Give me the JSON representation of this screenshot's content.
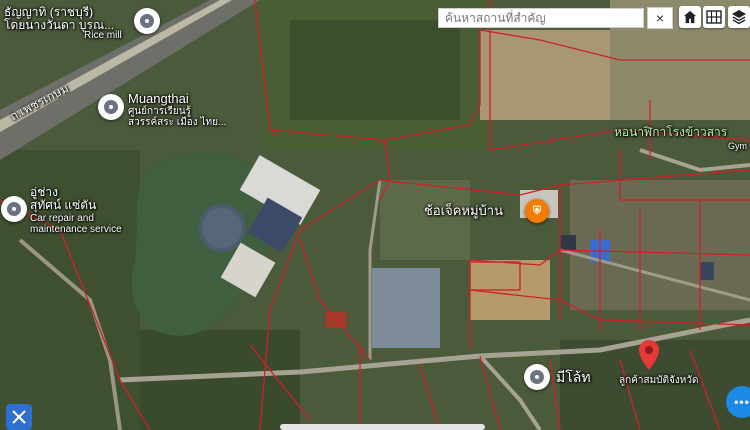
{
  "search": {
    "placeholder": "ค้นหาสถานที่สำคัญ",
    "clear_label": "×"
  },
  "controls": {
    "home_icon": "home-icon",
    "grid_icon": "grid-icon",
    "layers_icon": "layers-icon"
  },
  "places": [
    {
      "name": "ธัญญาทิ (ราชบุรี)\nโดยนางวันดา บูรณ...",
      "sub": "Rice mill"
    },
    {
      "name": "Muangthai",
      "sub": "ศูนย์การเรียนรู้\nสวรรค์สระ เมือง ไทย..."
    },
    {
      "name": "อู่ช่าง\nสุทัศน์ แซ่ตัน",
      "sub": "Car repair and\nmaintenance service"
    },
    {
      "name": "ช้อเจ็คหมู่บ้าน",
      "sub": ""
    },
    {
      "name": "หอนาฬิกาโรงข้าวสาร",
      "sub": "Gym"
    },
    {
      "name": "มีโล้ท",
      "sub": ""
    },
    {
      "name": "ลูกค้าสมบัติจังหวัด",
      "sub": ""
    }
  ],
  "road_label": "ถ.เพชรเกษม",
  "colors": {
    "parcel_line": "#d0202a",
    "pin_red": "#e53935",
    "shop_orange": "#f57c00",
    "button_blue": "#1e88e5"
  },
  "icons": [
    "home-icon",
    "grid-icon",
    "layers-icon",
    "tools-icon",
    "more-icon",
    "location-pin-icon",
    "shop-icon"
  ],
  "more_label": "•••"
}
